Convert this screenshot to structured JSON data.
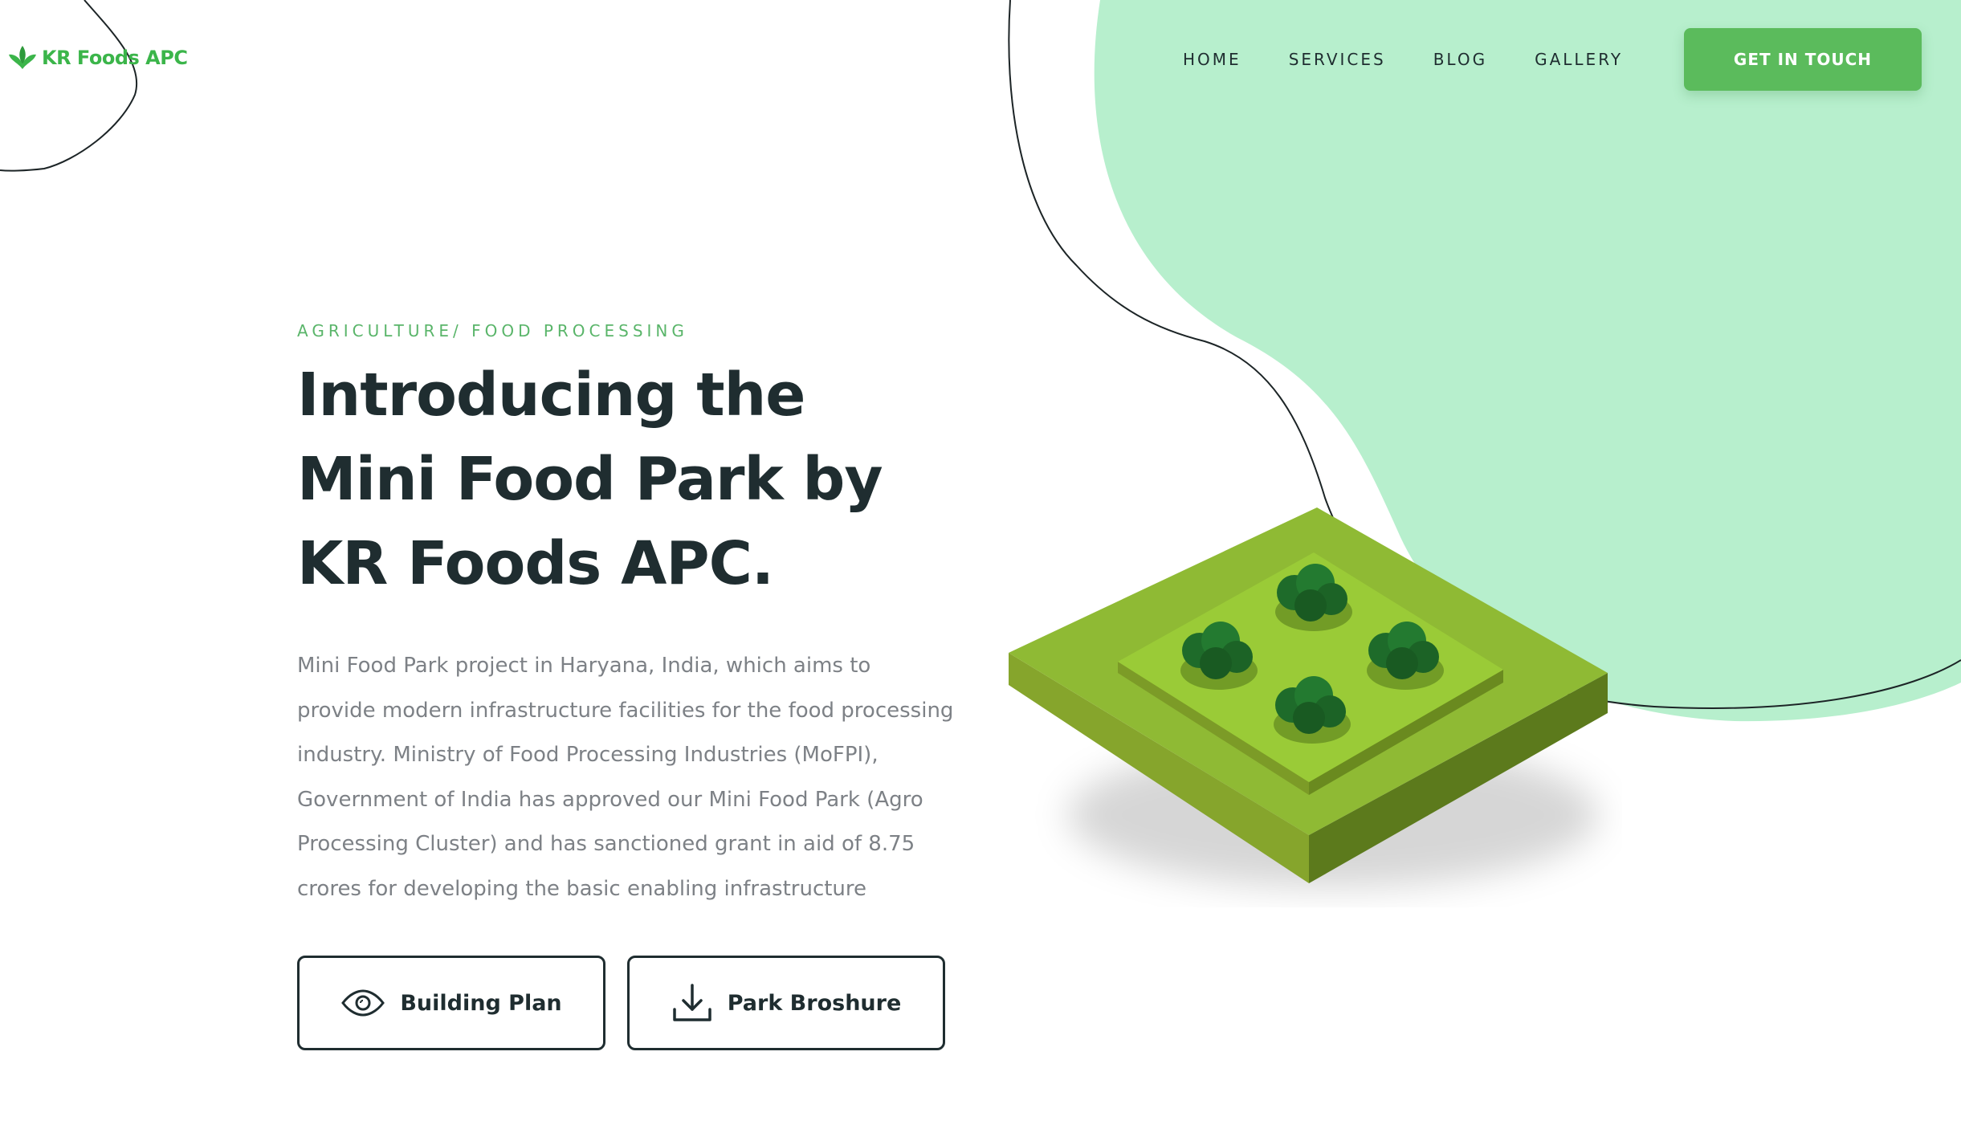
{
  "brand": {
    "name": "KR Foods APC",
    "accent_color": "#5bbb5c",
    "blob_color": "#b7efcd",
    "icon": "leaf-icon"
  },
  "nav": {
    "items": [
      {
        "label": "HOME"
      },
      {
        "label": "SERVICES"
      },
      {
        "label": "BLOG"
      },
      {
        "label": "GALLERY"
      }
    ],
    "cta_label": "GET IN TOUCH"
  },
  "hero": {
    "eyebrow": "AGRICULTURE/ FOOD PROCESSING",
    "headline": "Introducing the Mini Food Park by KR Foods APC.",
    "description": "Mini Food Park project in Haryana, India, which aims to provide modern infrastructure facilities for the food processing industry. Ministry of Food Processing Industries (MoFPI), Government of India has approved our Mini Food Park (Agro Processing Cluster) and has sanctioned grant in aid of 8.75 crores for developing the basic enabling infrastructure",
    "buttons": [
      {
        "label": "Building Plan",
        "icon": "eye-icon"
      },
      {
        "label": "Park Broshure",
        "icon": "download-icon"
      }
    ]
  },
  "illustration": {
    "subject": "isometric-park-tile-icon",
    "tree_count": 4
  }
}
